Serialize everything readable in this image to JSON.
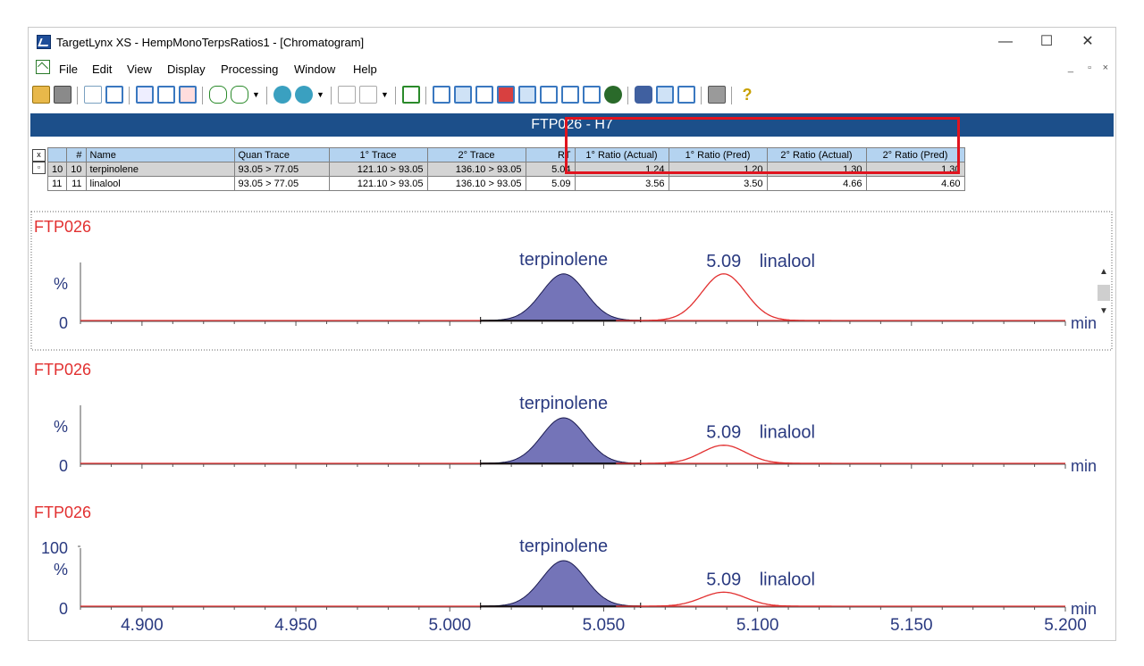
{
  "titlebar": {
    "title": "TargetLynx XS - HempMonoTerpsRatios1 - [Chromatogram]",
    "minimize": "—",
    "maximize": "☐",
    "close": "✕"
  },
  "menu": {
    "items": [
      "File",
      "Edit",
      "View",
      "Display",
      "Processing",
      "Window",
      "Help"
    ],
    "mdi": [
      "_",
      "▫",
      "×"
    ]
  },
  "toolbar": {
    "icons": [
      "open-icon",
      "save-icon",
      "integrate-icon",
      "peak-detect-icon",
      "report-icon",
      "display-icon",
      "print-preview-icon",
      "first-sample-icon",
      "next-sample-icon",
      "dropdown-icon",
      "prev-compound-icon",
      "next-compound-icon",
      "dropdown-icon",
      "first-peak-icon",
      "last-peak-icon",
      "dropdown-icon",
      "zoom-fit-icon",
      "spectrum-icon",
      "chromatogram-icon",
      "bar-chart-icon",
      "color-chart-icon",
      "table-icon",
      "sum-icon",
      "calibration-icon",
      "book-icon",
      "globe-icon",
      "eraser-icon",
      "horizontal-split-icon",
      "vertical-split-icon",
      "printer-icon",
      "help-icon"
    ]
  },
  "banner": {
    "text": "FTP026 - H7"
  },
  "table": {
    "headers": [
      "#",
      "Name",
      "Quan Trace",
      "1° Trace",
      "2° Trace",
      "RT",
      "1° Ratio (Actual)",
      "1° Ratio (Pred)",
      "2° Ratio (Actual)",
      "2° Ratio (Pred)"
    ],
    "rows": [
      {
        "row": "10",
        "num": "10",
        "name": "terpinolene",
        "quan": "93.05 > 77.05",
        "t1": "121.10 > 93.05",
        "t2": "136.10 > 93.05",
        "rt": "5.04",
        "r1a": "1.24",
        "r1p": "1.20",
        "r2a": "1.30",
        "r2p": "1.30"
      },
      {
        "row": "11",
        "num": "11",
        "name": "linalool",
        "quan": "93.05 > 77.05",
        "t1": "121.10 > 93.05",
        "t2": "136.10 > 93.05",
        "rt": "5.09",
        "r1a": "3.56",
        "r1p": "3.50",
        "r2a": "4.66",
        "r2p": "4.60"
      }
    ]
  },
  "chart_data": [
    {
      "type": "line",
      "title": "FTP026",
      "xlabel": "min",
      "ylabel": "%",
      "xlim": [
        4.88,
        5.2
      ],
      "y_ticks": [
        "0"
      ],
      "series": [
        {
          "name": "terpinolene",
          "peak_rt": 5.037,
          "height_frac": 0.9,
          "filled": true,
          "color": "#7474b8",
          "baseline_range": [
            5.01,
            5.062
          ]
        },
        {
          "name": "linalool",
          "peak_rt": 5.089,
          "height_frac": 0.9,
          "filled": false,
          "color": "#e23030"
        }
      ],
      "annotations": [
        {
          "text": "terpinolene"
        },
        {
          "text": "5.09"
        },
        {
          "text": "linalool"
        }
      ]
    },
    {
      "type": "line",
      "title": "FTP026",
      "xlabel": "min",
      "ylabel": "%",
      "xlim": [
        4.88,
        5.2
      ],
      "y_ticks": [
        "0"
      ],
      "series": [
        {
          "name": "terpinolene",
          "peak_rt": 5.037,
          "height_frac": 0.88,
          "filled": true,
          "color": "#7474b8",
          "baseline_range": [
            5.01,
            5.062
          ]
        },
        {
          "name": "linalool",
          "peak_rt": 5.089,
          "height_frac": 0.35,
          "filled": false,
          "color": "#e23030"
        }
      ],
      "annotations": [
        {
          "text": "terpinolene"
        },
        {
          "text": "5.09"
        },
        {
          "text": "linalool"
        }
      ]
    },
    {
      "type": "line",
      "title": "FTP026",
      "xlabel": "min",
      "ylabel": "%",
      "xlim": [
        4.88,
        5.2
      ],
      "y_ticks": [
        "100",
        "0"
      ],
      "x_ticks": [
        "4.900",
        "4.950",
        "5.000",
        "5.050",
        "5.100",
        "5.150",
        "5.200"
      ],
      "series": [
        {
          "name": "terpinolene",
          "peak_rt": 5.037,
          "height_frac": 0.88,
          "filled": true,
          "color": "#7474b8",
          "baseline_range": [
            5.01,
            5.062
          ]
        },
        {
          "name": "linalool",
          "peak_rt": 5.089,
          "height_frac": 0.27,
          "filled": false,
          "color": "#e23030"
        }
      ],
      "annotations": [
        {
          "text": "terpinolene"
        },
        {
          "text": "5.09"
        },
        {
          "text": "linalool"
        }
      ]
    }
  ]
}
